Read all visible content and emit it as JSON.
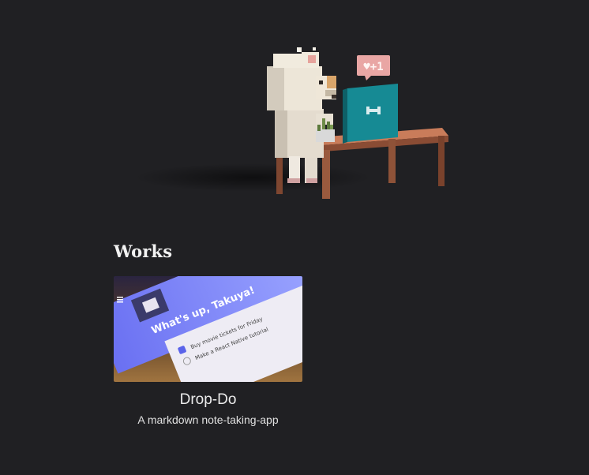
{
  "hero": {
    "image": "voxel-dog-at-desk",
    "bubble_text": "♥+1"
  },
  "works_section": {
    "title": "Works",
    "items": [
      {
        "title": "Drop-Do",
        "description": "A markdown note-taking-app",
        "thumbnail": {
          "header_text": "What's up, Takuya!",
          "tasks": [
            "Buy movie tickets for Friday",
            "Make a React Native tutorial"
          ]
        }
      }
    ]
  }
}
